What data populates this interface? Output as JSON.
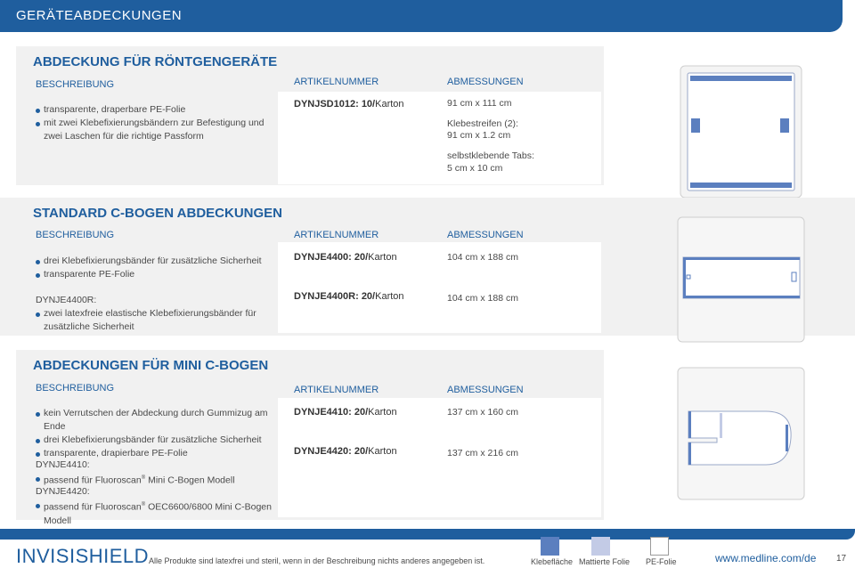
{
  "header": {
    "title": "GERÄTEABDECKUNGEN"
  },
  "section1": {
    "title": "ABDECKUNG FÜR RÖNTGENGERÄTE",
    "desc_label": "BESCHREIBUNG",
    "art_label": "ARTIKELNUMMER",
    "dim_label": "ABMESSUNGEN",
    "bullets": [
      "transparente, draperbare PE-Folie",
      "mit zwei Klebefixierungsbändern zur Befestigung und zwei Laschen für die richtige Passform"
    ],
    "article_code": "DYNJSD1012: 10/",
    "article_unit": "Karton",
    "dims": [
      "91 cm x 111 cm",
      "Klebestreifen (2):",
      "91 cm x 1.2 cm",
      "selbstklebende Tabs:",
      "5 cm x 10 cm"
    ]
  },
  "section2": {
    "title": "STANDARD C-BOGEN ABDECKUNGEN",
    "desc_label": "BESCHREIBUNG",
    "art_label": "ARTIKELNUMMER",
    "dim_label": "ABMESSUNGEN",
    "bullets": [
      "drei Klebefixierungsbänder für zusätzliche Sicherheit",
      "transparente PE-Folie"
    ],
    "sub_label": "DYNJE4400R:",
    "sub_bullets": [
      "zwei latexfreie elastische Klebefixierungsbänder für zusätzliche Sicherheit"
    ],
    "articles": [
      {
        "code": "DYNJE4400: 20/",
        "unit": "Karton",
        "dim": "104 cm x 188 cm"
      },
      {
        "code": "DYNJE4400R: 20/",
        "unit": "Karton",
        "dim": "104 cm x 188 cm"
      }
    ]
  },
  "section3": {
    "title": "ABDECKUNGEN FÜR MINI C-BOGEN",
    "desc_label": "BESCHREIBUNG",
    "art_label": "ARTIKELNUMMER",
    "dim_label": "ABMESSUNGEN",
    "bullets": [
      "kein Verrutschen der Abdeckung durch Gummizug am Ende",
      "drei Klebefixierungsbänder für zusätzliche Sicherheit",
      "transparente, drapierbare PE-Folie"
    ],
    "sub1_label": "DYNJE4410:",
    "sub1_prefix": "passend für Fluoroscan",
    "sub1_suffix": " Mini C-Bogen Modell",
    "sub2_label": "DYNJE4420:",
    "sub2_prefix": "passend für Fluoroscan",
    "sub2_suffix": " OEC6600/6800 Mini C-Bogen Modell",
    "reg": "®",
    "articles": [
      {
        "code": "DYNJE4410: 20/",
        "unit": "Karton",
        "dim": "137 cm x 160 cm"
      },
      {
        "code": "DYNJE4420: 20/",
        "unit": "Karton",
        "dim": "137 cm x 216 cm"
      }
    ]
  },
  "footer": {
    "brand": "INVISISHIELD",
    "note": "Alle Produkte sind latexfrei und steril, wenn in der Beschreibung nichts anderes angegeben ist.",
    "legend": [
      {
        "label": "Klebefläche",
        "color": "#5b7fbf"
      },
      {
        "label": "Mattierte Folie",
        "color": "#c3cbe6"
      },
      {
        "label": "PE-Folie",
        "color": "#ffffff"
      }
    ],
    "url": "www.medline.com/de",
    "page": "17"
  },
  "colors": {
    "primary": "#1f5e9e",
    "panel": "#f1f1f1"
  }
}
